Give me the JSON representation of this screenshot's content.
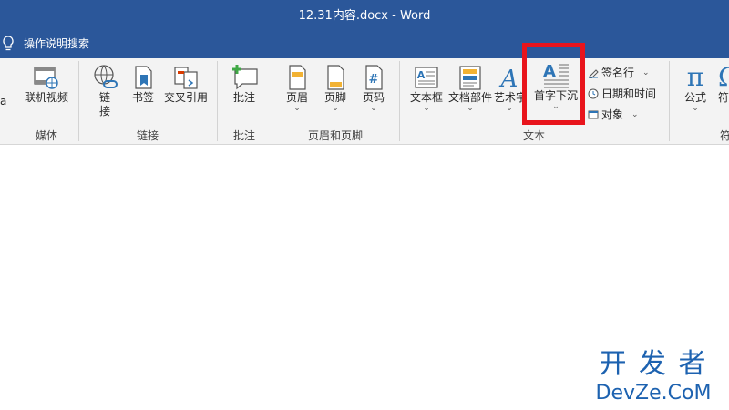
{
  "window": {
    "title": "12.31内容.docx  -  Word"
  },
  "tell_me": {
    "label": "操作说明搜索"
  },
  "ribbon": {
    "edge_fragment_left": "a",
    "buttons": {
      "online_video": "联机视频",
      "link_1": "链",
      "link_2": "接",
      "bookmark": "书签",
      "cross_ref": "交叉引用",
      "comment": "批注",
      "header": "页眉",
      "footer": "页脚",
      "page_number": "页码",
      "text_box": "文本框",
      "quick_parts": "文档部件",
      "wordart": "艺术字",
      "drop_cap": "首字下沉",
      "signature_line": "签名行",
      "date_time": "日期和时间",
      "object": "对象",
      "equation": "公式",
      "symbol_fragment": "符"
    },
    "groups": {
      "media": "媒体",
      "links": "链接",
      "comments": "批注",
      "header_footer": "页眉和页脚",
      "text": "文本",
      "symbols_fragment": "符"
    }
  },
  "watermark": {
    "line1": "开 发 者",
    "line2": "DevZe.CoM"
  },
  "colors": {
    "titlebar": "#2b579a",
    "highlight": "#e8141c",
    "accent": "#2e75b6"
  },
  "icons": [
    "lightbulb-icon",
    "online-video-icon",
    "link-icon",
    "bookmark-icon",
    "cross-reference-icon",
    "comment-icon",
    "header-icon",
    "footer-icon",
    "page-number-icon",
    "text-box-icon",
    "quick-parts-icon",
    "wordart-icon",
    "drop-cap-icon",
    "signature-line-icon",
    "date-time-icon",
    "object-icon",
    "equation-icon",
    "symbol-icon"
  ]
}
